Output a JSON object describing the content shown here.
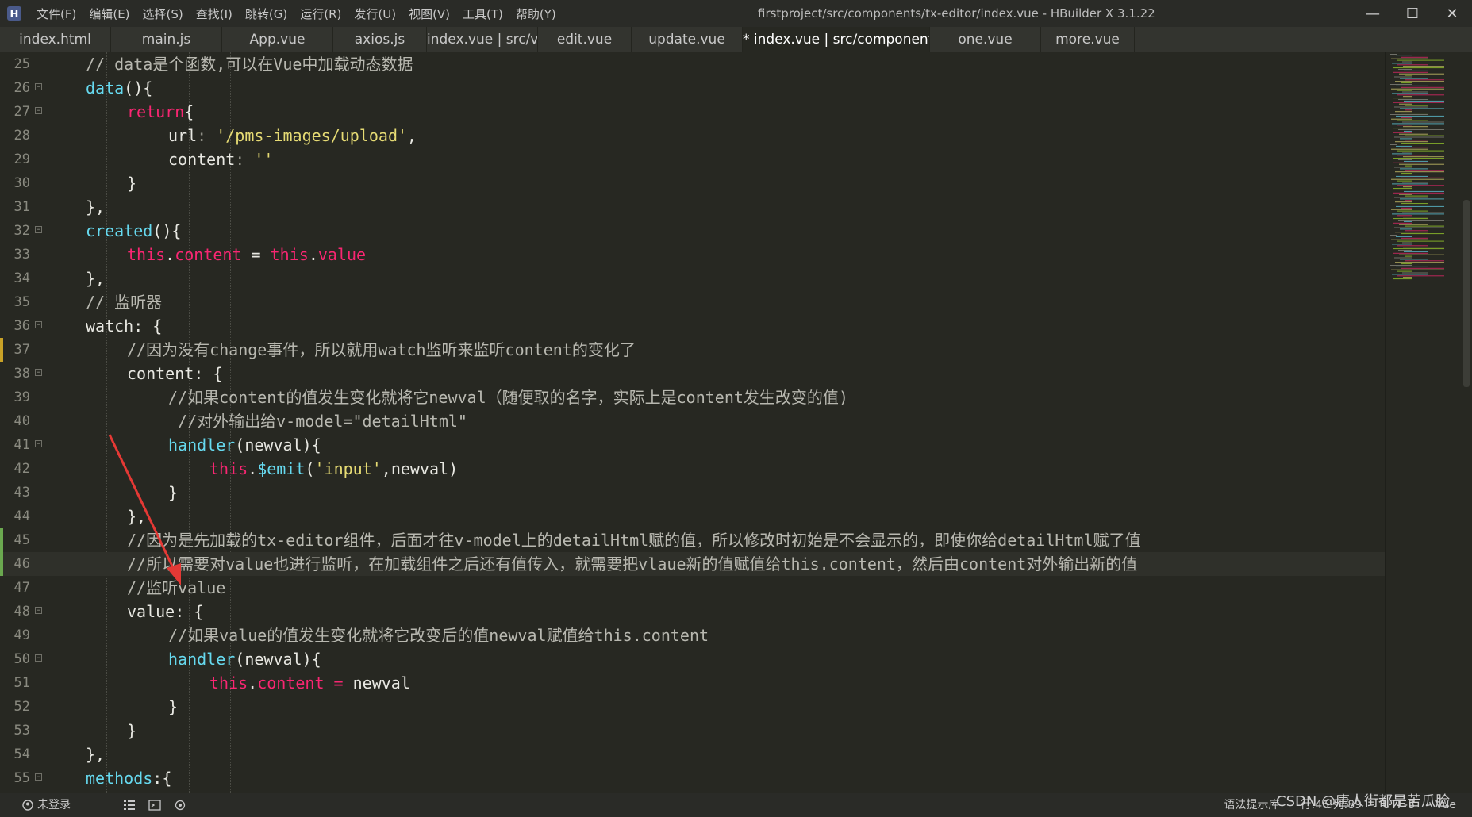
{
  "window": {
    "title": "firstproject/src/components/tx-editor/index.vue - HBuilder X 3.1.22",
    "menu": [
      "文件(F)",
      "编辑(E)",
      "选择(S)",
      "查找(I)",
      "跳转(G)",
      "运行(R)",
      "发行(U)",
      "视图(V)",
      "工具(T)",
      "帮助(Y)"
    ],
    "controls": {
      "minimize": "—",
      "maximize": "☐",
      "close": "✕"
    }
  },
  "tabs": [
    {
      "label": "index.html"
    },
    {
      "label": "main.js"
    },
    {
      "label": "App.vue"
    },
    {
      "label": "axios.js"
    },
    {
      "label": "index.vue | src/views/product"
    },
    {
      "label": "edit.vue"
    },
    {
      "label": "update.vue"
    },
    {
      "label": "* index.vue | src/components/tx-editor"
    },
    {
      "label": "one.vue"
    },
    {
      "label": "more.vue"
    }
  ],
  "active_tab_index": 7,
  "editor": {
    "current_line": 46,
    "lines": [
      {
        "n": "25",
        "fold": false,
        "mod": "",
        "indent": 2,
        "tokens": [
          [
            "// data是个函数,可以在Vue中加载动态数据",
            "cn"
          ]
        ]
      },
      {
        "n": "26",
        "fold": true,
        "mod": "",
        "indent": 2,
        "tokens": [
          [
            "data",
            "fn"
          ],
          [
            "(){",
            "pl"
          ]
        ]
      },
      {
        "n": "27",
        "fold": true,
        "mod": "",
        "indent": 4,
        "tokens": [
          [
            "return",
            "kw"
          ],
          [
            "{",
            "pl"
          ]
        ]
      },
      {
        "n": "28",
        "fold": false,
        "mod": "",
        "indent": 6,
        "tokens": [
          [
            "url",
            "pl"
          ],
          [
            ": ",
            "cm"
          ],
          [
            "'/pms-images/upload'",
            "str"
          ],
          [
            ",",
            "pl"
          ]
        ]
      },
      {
        "n": "29",
        "fold": false,
        "mod": "",
        "indent": 6,
        "tokens": [
          [
            "content",
            "pl"
          ],
          [
            ": ",
            "cm"
          ],
          [
            "''",
            "str"
          ]
        ]
      },
      {
        "n": "30",
        "fold": false,
        "mod": "",
        "indent": 4,
        "tokens": [
          [
            "}",
            "pl"
          ]
        ]
      },
      {
        "n": "31",
        "fold": false,
        "mod": "",
        "indent": 2,
        "tokens": [
          [
            "},",
            "pl"
          ]
        ]
      },
      {
        "n": "32",
        "fold": true,
        "mod": "",
        "indent": 2,
        "tokens": [
          [
            "created",
            "fn"
          ],
          [
            "(){",
            "pl"
          ]
        ]
      },
      {
        "n": "33",
        "fold": false,
        "mod": "",
        "indent": 4,
        "tokens": [
          [
            "this",
            "kw"
          ],
          [
            ".",
            "pl"
          ],
          [
            "content",
            "kw"
          ],
          [
            " = ",
            "pl"
          ],
          [
            "this",
            "kw"
          ],
          [
            ".",
            "pl"
          ],
          [
            "value",
            "kw"
          ]
        ]
      },
      {
        "n": "34",
        "fold": false,
        "mod": "",
        "indent": 2,
        "tokens": [
          [
            "},",
            "pl"
          ]
        ]
      },
      {
        "n": "35",
        "fold": false,
        "mod": "",
        "indent": 2,
        "tokens": [
          [
            "// 监听器",
            "cn"
          ]
        ]
      },
      {
        "n": "36",
        "fold": true,
        "mod": "",
        "indent": 2,
        "tokens": [
          [
            "watch",
            "pl"
          ],
          [
            ": {",
            "pl"
          ]
        ]
      },
      {
        "n": "37",
        "fold": false,
        "mod": "#c9a227",
        "indent": 4,
        "tokens": [
          [
            "//因为没有change事件，所以就用watch监听来监听content的变化了",
            "cn"
          ]
        ]
      },
      {
        "n": "38",
        "fold": true,
        "mod": "",
        "indent": 4,
        "tokens": [
          [
            "content",
            "pl"
          ],
          [
            ": {",
            "pl"
          ]
        ]
      },
      {
        "n": "39",
        "fold": false,
        "mod": "",
        "indent": 6,
        "tokens": [
          [
            "//如果content的值发生变化就将它newval（随便取的名字，实际上是content发生改变的值)",
            "cn"
          ]
        ]
      },
      {
        "n": "40",
        "fold": false,
        "mod": "",
        "indent": 6,
        "tokens": [
          [
            " //对外输出给v-model=\"detailHtml\"",
            "cn"
          ]
        ]
      },
      {
        "n": "41",
        "fold": true,
        "mod": "",
        "indent": 6,
        "tokens": [
          [
            "handler",
            "fn"
          ],
          [
            "(newval){",
            "pl"
          ]
        ]
      },
      {
        "n": "42",
        "fold": false,
        "mod": "",
        "indent": 8,
        "tokens": [
          [
            "this",
            "kw"
          ],
          [
            ".",
            "pl"
          ],
          [
            "$emit",
            "fn"
          ],
          [
            "(",
            "pl"
          ],
          [
            "'input'",
            "str"
          ],
          [
            ",newval)",
            "pl"
          ]
        ]
      },
      {
        "n": "43",
        "fold": false,
        "mod": "",
        "indent": 6,
        "tokens": [
          [
            "}",
            "pl"
          ]
        ]
      },
      {
        "n": "44",
        "fold": false,
        "mod": "",
        "indent": 4,
        "tokens": [
          [
            "},",
            "pl"
          ]
        ]
      },
      {
        "n": "45",
        "fold": false,
        "mod": "#6aa84f",
        "indent": 4,
        "tokens": [
          [
            "//因为是先加载的tx-editor组件，后面才往v-model上的detailHtml赋的值，所以修改时初始是不会显示的，即使你给detailHtml赋了值",
            "cn"
          ]
        ]
      },
      {
        "n": "46",
        "fold": false,
        "mod": "#6aa84f",
        "indent": 4,
        "tokens": [
          [
            "//所以需要对value也进行监听，在加载组件之后还有值传入，就需要把vlaue新的值赋值给this.content，然后由content对外输出新的值",
            "cn"
          ]
        ]
      },
      {
        "n": "47",
        "fold": false,
        "mod": "",
        "indent": 4,
        "tokens": [
          [
            "//监听value",
            "cn"
          ]
        ]
      },
      {
        "n": "48",
        "fold": true,
        "mod": "",
        "indent": 4,
        "tokens": [
          [
            "value",
            "pl"
          ],
          [
            ": {",
            "pl"
          ]
        ]
      },
      {
        "n": "49",
        "fold": false,
        "mod": "",
        "indent": 6,
        "tokens": [
          [
            "//如果value的值发生变化就将它改变后的值newval赋值给this.content",
            "cn"
          ]
        ]
      },
      {
        "n": "50",
        "fold": true,
        "mod": "",
        "indent": 6,
        "tokens": [
          [
            "handler",
            "fn"
          ],
          [
            "(newval){",
            "pl"
          ]
        ]
      },
      {
        "n": "51",
        "fold": false,
        "mod": "",
        "indent": 8,
        "tokens": [
          [
            "this",
            "kw"
          ],
          [
            ".",
            "pl"
          ],
          [
            "content",
            "kw"
          ],
          [
            " = ",
            "kw"
          ],
          [
            "newval",
            "pl"
          ]
        ]
      },
      {
        "n": "52",
        "fold": false,
        "mod": "",
        "indent": 6,
        "tokens": [
          [
            "}",
            "pl"
          ]
        ]
      },
      {
        "n": "53",
        "fold": false,
        "mod": "",
        "indent": 4,
        "tokens": [
          [
            "}",
            "pl"
          ]
        ]
      },
      {
        "n": "54",
        "fold": false,
        "mod": "",
        "indent": 2,
        "tokens": [
          [
            "},",
            "pl"
          ]
        ]
      },
      {
        "n": "55",
        "fold": true,
        "mod": "",
        "indent": 2,
        "tokens": [
          [
            "methods",
            "fn"
          ],
          [
            ":{",
            "pl"
          ]
        ]
      }
    ]
  },
  "statusbar": {
    "user": "未登录",
    "syntax_lib": "语法提示库",
    "position": "行:46  列:89",
    "encoding": "UTF-8",
    "language": "Vue"
  },
  "watermark": "CSDN @唐人街都是苦瓜脸",
  "colors": {
    "background": "#272822",
    "comment": "#b8b8b0",
    "function": "#66d9ef",
    "keyword": "#f92672",
    "string": "#e6db74",
    "annotation_arrow": "#e53935"
  }
}
